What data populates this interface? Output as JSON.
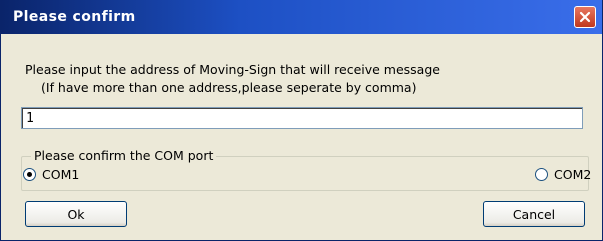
{
  "window": {
    "title": "Please confirm",
    "close_icon": "close-icon"
  },
  "prompt": {
    "line1": "Please input the address of Moving-Sign that will receive message",
    "line2": "(If have more than one address,please seperate by comma)"
  },
  "address_input": {
    "value": "1"
  },
  "com_group": {
    "legend": "Please confirm the COM port",
    "options": [
      {
        "label": "COM1",
        "checked": true
      },
      {
        "label": "COM2",
        "checked": false
      }
    ]
  },
  "buttons": {
    "ok_label": "Ok",
    "cancel_label": "Cancel"
  },
  "colors": {
    "titlebar_start": "#0A246A",
    "titlebar_end": "#3A6EEA",
    "close_button": "#C0381E",
    "dialog_face": "#ECE9D8",
    "selection": "#316AC5"
  }
}
